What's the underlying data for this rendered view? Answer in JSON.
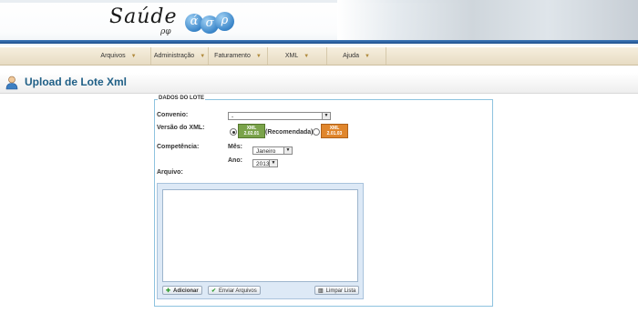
{
  "header": {
    "logo_text": "Saúde",
    "logo_sub": "ρφ",
    "bubbles": [
      "ά",
      "σ",
      "ρ"
    ]
  },
  "menu": {
    "items": [
      {
        "label": "Arquivos"
      },
      {
        "label": "Administração"
      },
      {
        "label": "Faturamento"
      },
      {
        "label": "XML"
      },
      {
        "label": "Ajuda"
      }
    ],
    "arrow_glyph": "▼"
  },
  "page": {
    "title": "Upload de Lote Xml"
  },
  "form": {
    "legend": "DADOS DO LOTE",
    "convenio_label": "Convenio:",
    "convenio_value": "-",
    "versao_label": "Versão do XML:",
    "versao_badge1": {
      "line1": "XML",
      "line2": "2.02.01",
      "color": "#7aa34a"
    },
    "versao_recomendada": "(Recomendada)",
    "versao_badge2": {
      "line1": "XML",
      "line2": "2.01.03",
      "color": "#e0862c"
    },
    "competencia_label": "Competência:",
    "mes_label": "Mês:",
    "mes_value": "Janeiro",
    "ano_label": "Ano:",
    "ano_value": "2013",
    "arquivo_label": "Arquivo:"
  },
  "upload": {
    "add_label": "Adicionar",
    "send_label": "Enviar Arquivos",
    "clear_label": "Limpar Lista"
  }
}
